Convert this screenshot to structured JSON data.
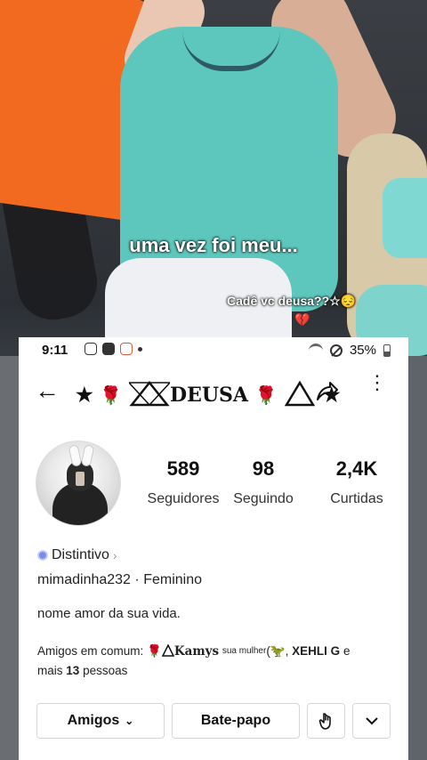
{
  "video": {
    "caption_main": "uma vez foi meu...",
    "caption_small": "Cadê vc deusa??☆😔",
    "caption_heart": "💔"
  },
  "status_bar": {
    "time": "9:11",
    "battery": "35%"
  },
  "profile": {
    "title_prefix": "★",
    "title_rose": "🌹",
    "title_name": "DEUSA",
    "title_suffix": "★",
    "stats": [
      {
        "value": "589",
        "label": "Seguidores"
      },
      {
        "value": "98",
        "label": "Seguindo"
      },
      {
        "value": "2,4K",
        "label": "Curtidas"
      }
    ],
    "badge": "Distintivo",
    "username": "mimadinha232",
    "gender": "Feminino",
    "bio": "nome amor da sua vida.",
    "mutual": {
      "prefix": "Amigos em comum:",
      "name1": "Kamys",
      "name1_sup": "sua mulher",
      "name2": "XEHLI G",
      "suffix_a": "e",
      "suffix_b": "mais",
      "count": "13",
      "suffix_c": "pessoas"
    },
    "buttons": {
      "friends": "Amigos",
      "chat": "Bate-papo"
    }
  },
  "colors": {
    "accent_red": "#c41616",
    "badge_blue": "#7b8de8"
  },
  "icons": [
    "back-arrow-icon",
    "share-icon",
    "more-vertical-icon",
    "wave-hand-icon",
    "chevron-down-icon"
  ]
}
